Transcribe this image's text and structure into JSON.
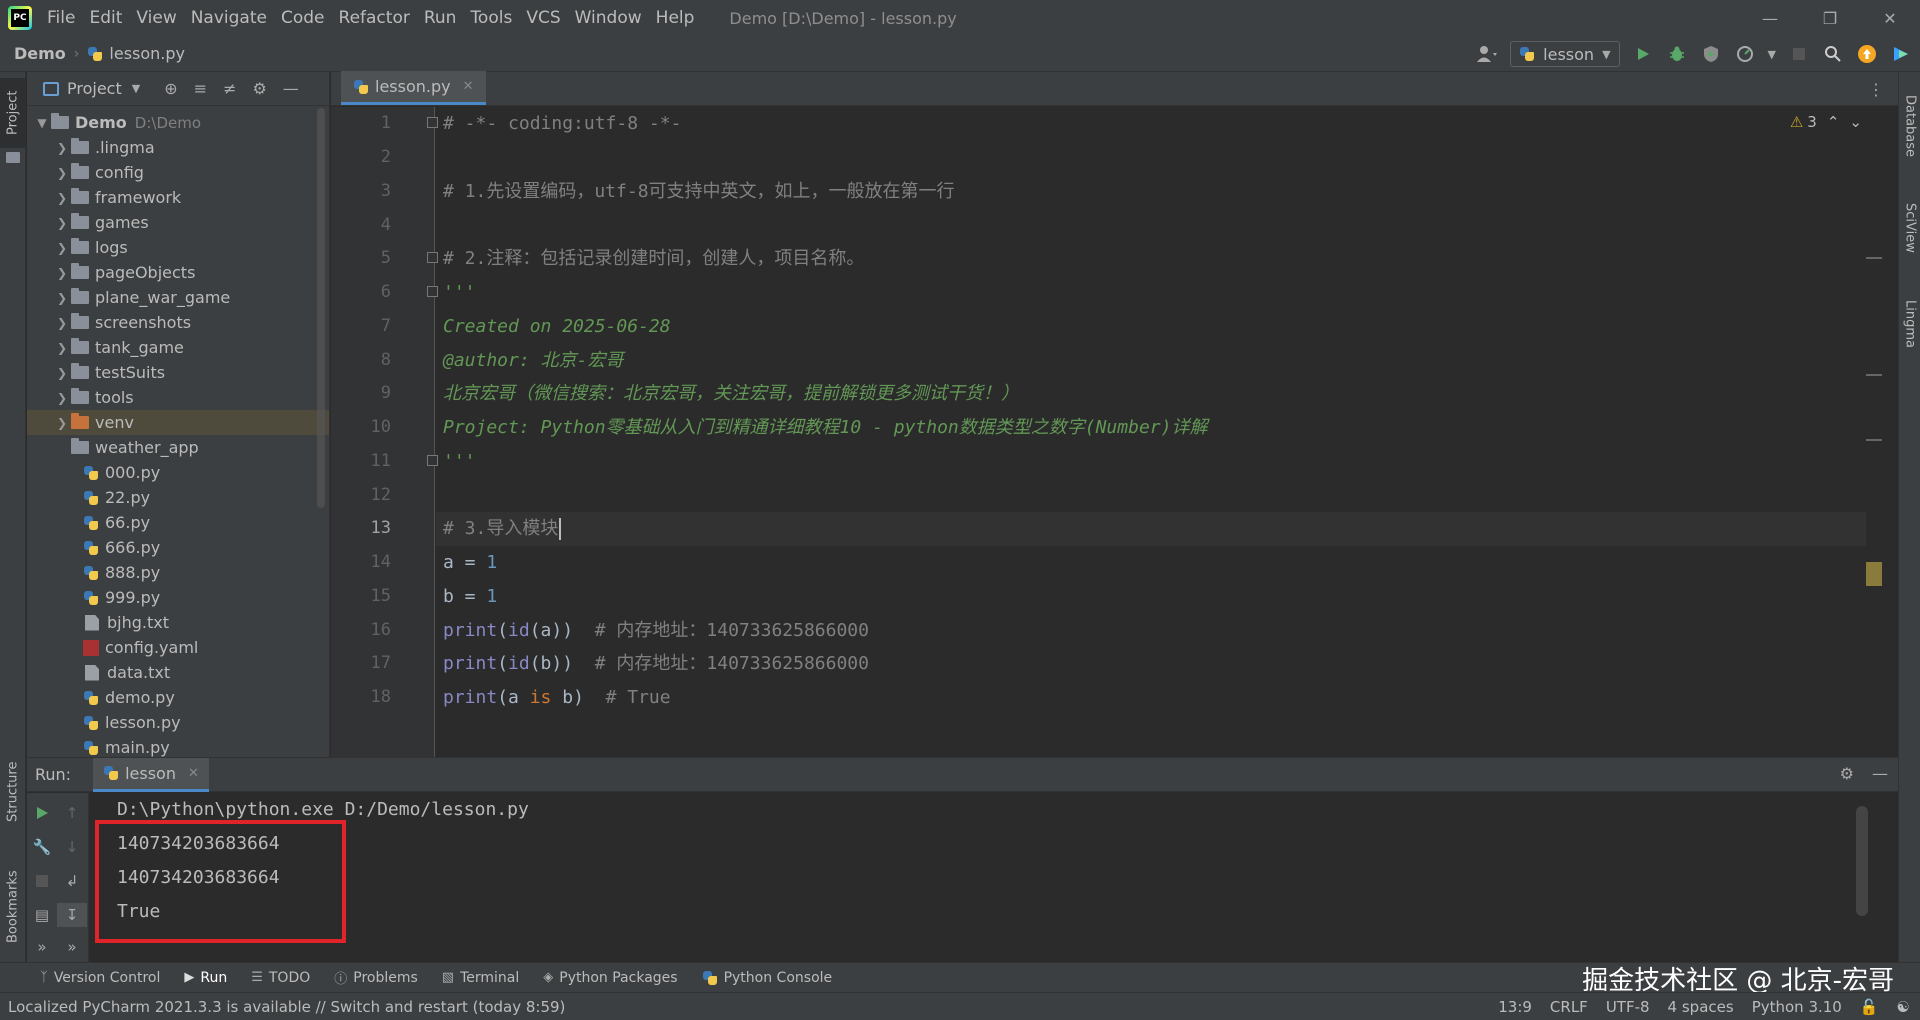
{
  "menubar": {
    "items": [
      "File",
      "Edit",
      "View",
      "Navigate",
      "Code",
      "Refactor",
      "Run",
      "Tools",
      "VCS",
      "Window",
      "Help"
    ],
    "window_title": "Demo [D:\\Demo] - lesson.py"
  },
  "navbar": {
    "project": "Demo",
    "file": "lesson.py",
    "run_config": "lesson"
  },
  "left_strip": {
    "project_tab": "Project",
    "structure_tab": "Structure",
    "bookmarks_tab": "Bookmarks"
  },
  "right_strip": {
    "database_tab": "Database",
    "sciview_tab": "SciView",
    "lingma_tab": "Lingma"
  },
  "project_panel": {
    "title": "Project",
    "root": {
      "name": "Demo",
      "path": "D:\\Demo"
    },
    "folders": [
      ".lingma",
      "config",
      "framework",
      "games",
      "logs",
      "pageObjects",
      "plane_war_game",
      "screenshots",
      "tank_game",
      "testSuits",
      "tools",
      "venv",
      "weather_app"
    ],
    "files": [
      "000.py",
      "22.py",
      "66.py",
      "666.py",
      "888.py",
      "999.py",
      "bjhg.txt",
      "config.yaml",
      "data.txt",
      "demo.py",
      "lesson.py",
      "main.py"
    ]
  },
  "editor": {
    "tab_label": "lesson.py",
    "inspection_count": "3",
    "line_numbers": [
      "1",
      "2",
      "3",
      "4",
      "5",
      "6",
      "7",
      "8",
      "9",
      "10",
      "11",
      "12",
      "13",
      "14",
      "15",
      "16",
      "17",
      "18"
    ],
    "current_line": "13",
    "lines": {
      "l1": "# -*- coding:utf-8 -*-",
      "l3": "# 1.先设置编码，utf-8可支持中英文，如上，一般放在第一行",
      "l5": "# 2.注释：包括记录创建时间，创建人，项目名称。",
      "l6": "'''",
      "l7": "Created on 2025-06-28",
      "l8": "@author: 北京-宏哥",
      "l9": "北京宏哥（微信搜索：北京宏哥，关注宏哥，提前解锁更多测试干货！）",
      "l10": "Project: Python零基础从入门到精通详细教程10 - python数据类型之数字(Number)详解",
      "l11": "'''",
      "l13": "# 3.导入模块",
      "l14_var": "a",
      "l14_op": " = ",
      "l14_num": "1",
      "l15_var": "b",
      "l15_op": " = ",
      "l15_num": "1",
      "l16_fn": "print",
      "l16_fn2": "id",
      "l16_arg": "(a)",
      "l16_close": ")",
      "l16_comment": "  # 内存地址：140733625866000",
      "l17_fn": "print",
      "l17_fn2": "id",
      "l17_arg": "(b)",
      "l17_close": ")",
      "l17_comment": "  # 内存地址：140733625866000",
      "l18_fn": "print",
      "l18_a": "(a ",
      "l18_kw": "is",
      "l18_b": " b)",
      "l18_comment": "  # True"
    }
  },
  "run_panel": {
    "label": "Run:",
    "tab": "lesson",
    "output": [
      "D:\\Python\\python.exe D:/Demo/lesson.py",
      "140734203683664",
      "140734203683664",
      "True"
    ]
  },
  "bottom_tools": [
    "Version Control",
    "Run",
    "TODO",
    "Problems",
    "Terminal",
    "Python Packages",
    "Python Console"
  ],
  "watermark": "掘金技术社区 @ 北京-宏哥",
  "statusbar": {
    "message": "Localized PyCharm 2021.3.3 is available // Switch and restart (today 8:59)",
    "position": "13:9",
    "line_sep": "CRLF",
    "encoding": "UTF-8",
    "indent": "4 spaces",
    "interpreter": "Python 3.10"
  },
  "colors": {
    "accent": "#4a88c7",
    "highlight_box": "#e0242a",
    "doc_string": "#629755",
    "comment": "#808080"
  }
}
